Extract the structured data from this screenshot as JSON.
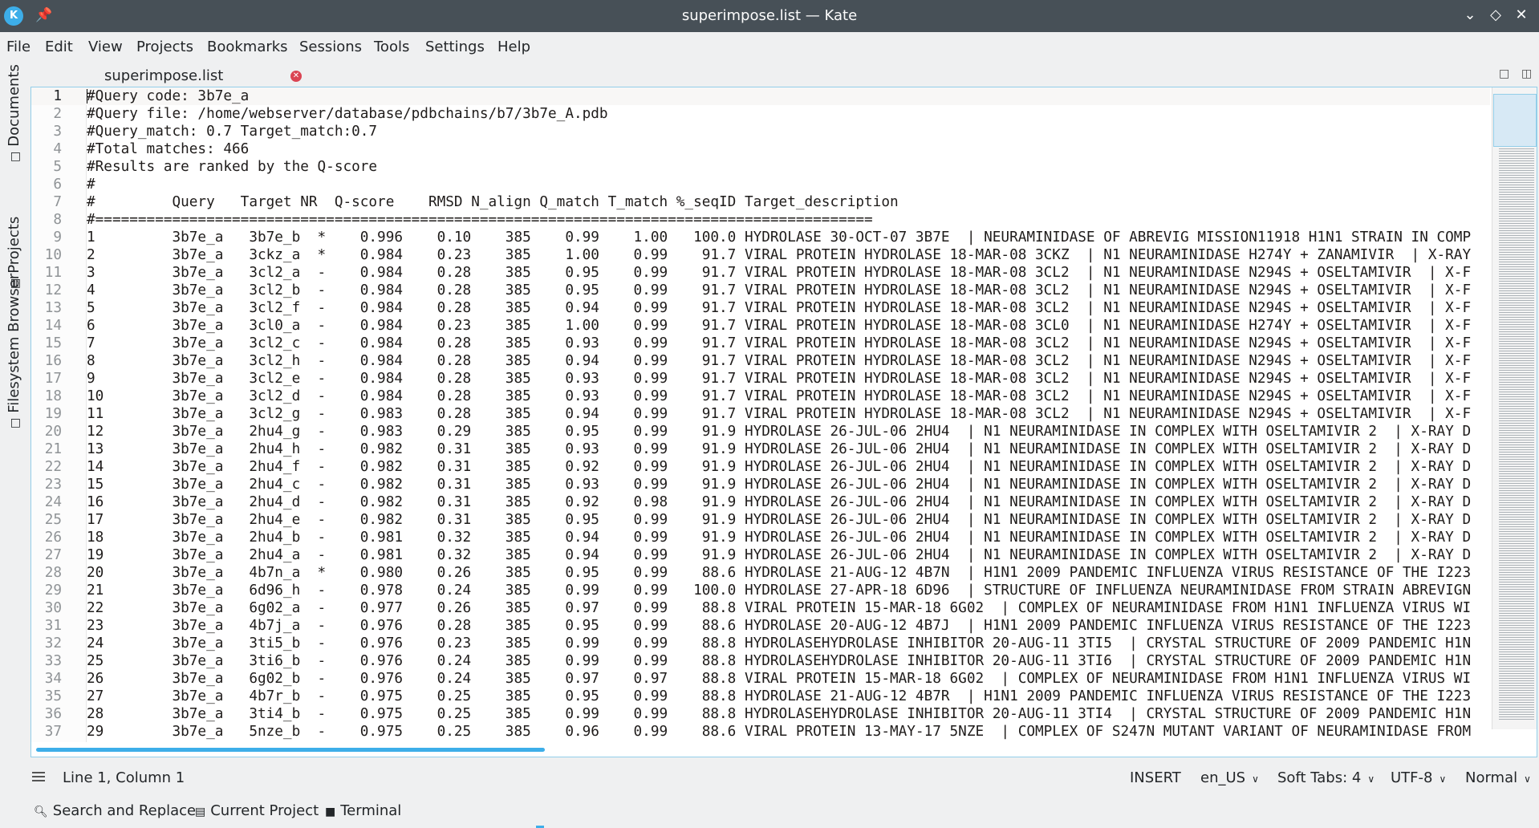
{
  "window": {
    "title": "superimpose.list — Kate",
    "app_icon": "kate-icon",
    "pin_icon": "pin-icon",
    "controls": [
      "minimize",
      "maximize",
      "close"
    ]
  },
  "menu": [
    "File",
    "Edit",
    "View",
    "Projects",
    "Bookmarks",
    "Sessions",
    "Tools",
    "Settings",
    "Help"
  ],
  "side_tabs": [
    "Documents",
    "Projects",
    "Filesystem Browser"
  ],
  "document_tab": {
    "label": "superimpose.list",
    "close_icon": "close-icon"
  },
  "editor": {
    "lines": [
      {
        "n": "1",
        "text": "#Query code: 3b7e_a"
      },
      {
        "n": "2",
        "text": "#Query file: /home/webserver/database/pdbchains/b7/3b7e_A.pdb"
      },
      {
        "n": "3",
        "text": "#Query_match: 0.7 Target_match:0.7"
      },
      {
        "n": "4",
        "text": "#Total matches: 466"
      },
      {
        "n": "5",
        "text": "#Results are ranked by the Q-score"
      },
      {
        "n": "6",
        "text": "#"
      },
      {
        "n": "7",
        "text": "#         Query   Target NR  Q-score    RMSD N_align Q_match T_match %_seqID Target_description"
      },
      {
        "n": "8",
        "text": "#==========================================================================================="
      },
      {
        "n": "9",
        "text": "1         3b7e_a   3b7e_b  *    0.996    0.10    385    0.99    1.00   100.0 HYDROLASE 30-OCT-07 3B7E  | NEURAMINIDASE OF ABREVIG MISSION11918 H1N1 STRAIN IN COMP"
      },
      {
        "n": "10",
        "text": "2         3b7e_a   3ckz_a  *    0.984    0.23    385    1.00    0.99    91.7 VIRAL PROTEIN HYDROLASE 18-MAR-08 3CKZ  | N1 NEURAMINIDASE H274Y + ZANAMIVIR  | X-RAY"
      },
      {
        "n": "11",
        "text": "3         3b7e_a   3cl2_a  -    0.984    0.28    385    0.95    0.99    91.7 VIRAL PROTEIN HYDROLASE 18-MAR-08 3CL2  | N1 NEURAMINIDASE N294S + OSELTAMIVIR  | X-F"
      },
      {
        "n": "12",
        "text": "4         3b7e_a   3cl2_b  -    0.984    0.28    385    0.95    0.99    91.7 VIRAL PROTEIN HYDROLASE 18-MAR-08 3CL2  | N1 NEURAMINIDASE N294S + OSELTAMIVIR  | X-F"
      },
      {
        "n": "13",
        "text": "5         3b7e_a   3cl2_f  -    0.984    0.28    385    0.94    0.99    91.7 VIRAL PROTEIN HYDROLASE 18-MAR-08 3CL2  | N1 NEURAMINIDASE N294S + OSELTAMIVIR  | X-F"
      },
      {
        "n": "14",
        "text": "6         3b7e_a   3cl0_a  -    0.984    0.23    385    1.00    0.99    91.7 VIRAL PROTEIN HYDROLASE 18-MAR-08 3CL0  | N1 NEURAMINIDASE H274Y + OSELTAMIVIR  | X-F"
      },
      {
        "n": "15",
        "text": "7         3b7e_a   3cl2_c  -    0.984    0.28    385    0.93    0.99    91.7 VIRAL PROTEIN HYDROLASE 18-MAR-08 3CL2  | N1 NEURAMINIDASE N294S + OSELTAMIVIR  | X-F"
      },
      {
        "n": "16",
        "text": "8         3b7e_a   3cl2_h  -    0.984    0.28    385    0.94    0.99    91.7 VIRAL PROTEIN HYDROLASE 18-MAR-08 3CL2  | N1 NEURAMINIDASE N294S + OSELTAMIVIR  | X-F"
      },
      {
        "n": "17",
        "text": "9         3b7e_a   3cl2_e  -    0.984    0.28    385    0.93    0.99    91.7 VIRAL PROTEIN HYDROLASE 18-MAR-08 3CL2  | N1 NEURAMINIDASE N294S + OSELTAMIVIR  | X-F"
      },
      {
        "n": "18",
        "text": "10        3b7e_a   3cl2_d  -    0.984    0.28    385    0.93    0.99    91.7 VIRAL PROTEIN HYDROLASE 18-MAR-08 3CL2  | N1 NEURAMINIDASE N294S + OSELTAMIVIR  | X-F"
      },
      {
        "n": "19",
        "text": "11        3b7e_a   3cl2_g  -    0.983    0.28    385    0.94    0.99    91.7 VIRAL PROTEIN HYDROLASE 18-MAR-08 3CL2  | N1 NEURAMINIDASE N294S + OSELTAMIVIR  | X-F"
      },
      {
        "n": "20",
        "text": "12        3b7e_a   2hu4_g  -    0.983    0.29    385    0.95    0.99    91.9 HYDROLASE 26-JUL-06 2HU4  | N1 NEURAMINIDASE IN COMPLEX WITH OSELTAMIVIR 2  | X-RAY D"
      },
      {
        "n": "21",
        "text": "13        3b7e_a   2hu4_h  -    0.982    0.31    385    0.93    0.99    91.9 HYDROLASE 26-JUL-06 2HU4  | N1 NEURAMINIDASE IN COMPLEX WITH OSELTAMIVIR 2  | X-RAY D"
      },
      {
        "n": "22",
        "text": "14        3b7e_a   2hu4_f  -    0.982    0.31    385    0.92    0.99    91.9 HYDROLASE 26-JUL-06 2HU4  | N1 NEURAMINIDASE IN COMPLEX WITH OSELTAMIVIR 2  | X-RAY D"
      },
      {
        "n": "23",
        "text": "15        3b7e_a   2hu4_c  -    0.982    0.31    385    0.93    0.99    91.9 HYDROLASE 26-JUL-06 2HU4  | N1 NEURAMINIDASE IN COMPLEX WITH OSELTAMIVIR 2  | X-RAY D"
      },
      {
        "n": "24",
        "text": "16        3b7e_a   2hu4_d  -    0.982    0.31    385    0.92    0.98    91.9 HYDROLASE 26-JUL-06 2HU4  | N1 NEURAMINIDASE IN COMPLEX WITH OSELTAMIVIR 2  | X-RAY D"
      },
      {
        "n": "25",
        "text": "17        3b7e_a   2hu4_e  -    0.982    0.31    385    0.95    0.99    91.9 HYDROLASE 26-JUL-06 2HU4  | N1 NEURAMINIDASE IN COMPLEX WITH OSELTAMIVIR 2  | X-RAY D"
      },
      {
        "n": "26",
        "text": "18        3b7e_a   2hu4_b  -    0.981    0.32    385    0.94    0.99    91.9 HYDROLASE 26-JUL-06 2HU4  | N1 NEURAMINIDASE IN COMPLEX WITH OSELTAMIVIR 2  | X-RAY D"
      },
      {
        "n": "27",
        "text": "19        3b7e_a   2hu4_a  -    0.981    0.32    385    0.94    0.99    91.9 HYDROLASE 26-JUL-06 2HU4  | N1 NEURAMINIDASE IN COMPLEX WITH OSELTAMIVIR 2  | X-RAY D"
      },
      {
        "n": "28",
        "text": "20        3b7e_a   4b7n_a  *    0.980    0.26    385    0.95    0.99    88.6 HYDROLASE 21-AUG-12 4B7N  | H1N1 2009 PANDEMIC INFLUENZA VIRUS RESISTANCE OF THE I223"
      },
      {
        "n": "29",
        "text": "21        3b7e_a   6d96_h  -    0.978    0.24    385    0.99    0.99   100.0 HYDROLASE 27-APR-18 6D96  | STRUCTURE OF INFLUENZA NEURAMINIDASE FROM STRAIN ABREVIGN"
      },
      {
        "n": "30",
        "text": "22        3b7e_a   6g02_a  -    0.977    0.26    385    0.97    0.99    88.8 VIRAL PROTEIN 15-MAR-18 6G02  | COMPLEX OF NEURAMINIDASE FROM H1N1 INFLUENZA VIRUS WI"
      },
      {
        "n": "31",
        "text": "23        3b7e_a   4b7j_a  -    0.976    0.28    385    0.95    0.99    88.6 HYDROLASE 20-AUG-12 4B7J  | H1N1 2009 PANDEMIC INFLUENZA VIRUS RESISTANCE OF THE I223"
      },
      {
        "n": "32",
        "text": "24        3b7e_a   3ti5_b  -    0.976    0.23    385    0.99    0.99    88.8 HYDROLASEHYDROLASE INHIBITOR 20-AUG-11 3TI5  | CRYSTAL STRUCTURE OF 2009 PANDEMIC H1N"
      },
      {
        "n": "33",
        "text": "25        3b7e_a   3ti6_b  -    0.976    0.24    385    0.99    0.99    88.8 HYDROLASEHYDROLASE INHIBITOR 20-AUG-11 3TI6  | CRYSTAL STRUCTURE OF 2009 PANDEMIC H1N"
      },
      {
        "n": "34",
        "text": "26        3b7e_a   6g02_b  -    0.976    0.24    385    0.97    0.97    88.8 VIRAL PROTEIN 15-MAR-18 6G02  | COMPLEX OF NEURAMINIDASE FROM H1N1 INFLUENZA VIRUS WI"
      },
      {
        "n": "35",
        "text": "27        3b7e_a   4b7r_b  -    0.975    0.25    385    0.95    0.99    88.8 HYDROLASE 21-AUG-12 4B7R  | H1N1 2009 PANDEMIC INFLUENZA VIRUS RESISTANCE OF THE I223"
      },
      {
        "n": "36",
        "text": "28        3b7e_a   3ti4_b  -    0.975    0.25    385    0.99    0.99    88.8 HYDROLASEHYDROLASE INHIBITOR 20-AUG-11 3TI4  | CRYSTAL STRUCTURE OF 2009 PANDEMIC H1N"
      },
      {
        "n": "37",
        "text": "29        3b7e_a   5nze_b  -    0.975    0.25    385    0.96    0.99    88.6 VIRAL PROTEIN 13-MAY-17 5NZE  | COMPLEX OF S247N MUTANT VARIANT OF NEURAMINIDASE FROM"
      }
    ]
  },
  "status": {
    "position": "Line 1, Column 1",
    "mode": "INSERT",
    "language": "en_US",
    "indent": "Soft Tabs: 4",
    "encoding": "UTF-8",
    "highlight": "Normal"
  },
  "toolviews": [
    "Search and Replace",
    "Current Project",
    "Terminal"
  ]
}
